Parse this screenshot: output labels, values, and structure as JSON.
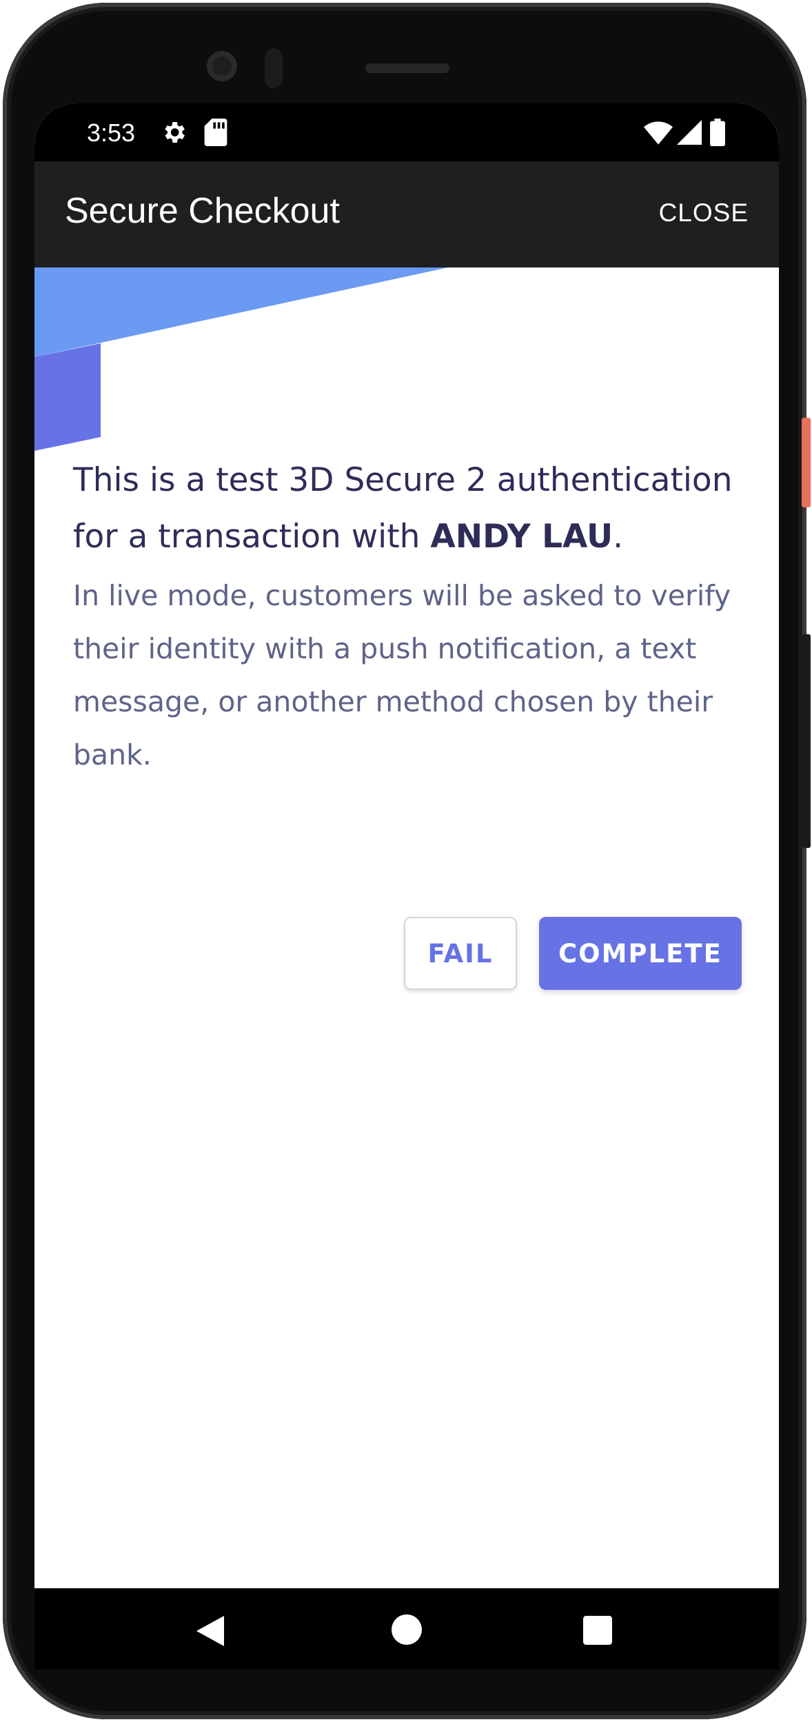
{
  "status_bar": {
    "time": "3:53",
    "icons": [
      "settings-icon",
      "sd-card-icon",
      "wifi-icon",
      "signal-icon",
      "battery-icon"
    ]
  },
  "app_bar": {
    "title": "Secure Checkout",
    "close_label": "CLOSE"
  },
  "challenge": {
    "heading_prefix": "This is a test 3D Secure 2 authentication for a transaction with ",
    "merchant": "ANDY LAU",
    "heading_suffix": ".",
    "description": "In live mode, customers will be asked to verify their identity with a push notification, a text message, or another method chosen by their bank."
  },
  "actions": {
    "fail_label": "FAIL",
    "complete_label": "COMPLETE"
  },
  "nav_bar": {
    "icons": [
      "back-icon",
      "home-icon",
      "recents-icon"
    ]
  },
  "colors": {
    "accent": "#6772e5",
    "banner_light": "#6b9af3",
    "banner_dark": "#6772e5",
    "heading_text": "#2e2c58",
    "body_text": "#5e6388"
  }
}
